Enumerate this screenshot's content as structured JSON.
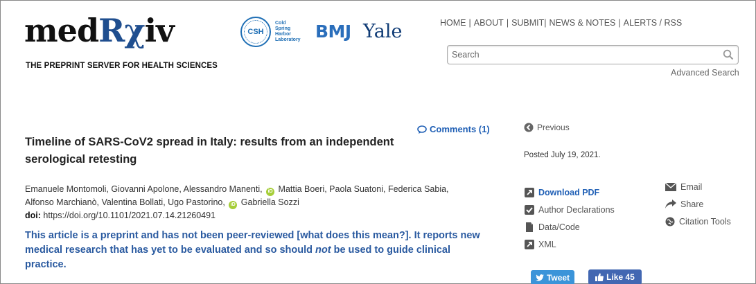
{
  "header": {
    "logo_pre": "med",
    "logo_rx": "Rχ",
    "logo_post": "iv",
    "tagline": "THE PREPRINT SERVER FOR HEALTH SCIENCES",
    "partners": {
      "csh_badge": "CSH",
      "csh_lines": [
        "Cold",
        "Spring",
        "Harbor",
        "Laboratory"
      ],
      "bmj": "BMJ",
      "yale": "Yale"
    },
    "nav": [
      "HOME",
      "ABOUT",
      "SUBMIT",
      "NEWS & NOTES",
      "ALERTS / RSS"
    ],
    "search_placeholder": "Search",
    "advanced_search": "Advanced Search"
  },
  "article": {
    "comments": "Comments (1)",
    "title": "Timeline of SARS-CoV2 spread in Italy: results from an independent serological retesting",
    "authors": {
      "a1": "Emanuele Montomoli, Giovanni Apolone, Alessandro Manenti,",
      "a2": "Mattia Boeri, Paola Suatoni, Federica Sabia,",
      "a3": "Alfonso Marchianò, Valentina Bollati, Ugo Pastorino,",
      "a4": "Gabriella Sozzi",
      "orcid_badge": "iD"
    },
    "doi_label": "doi:",
    "doi_value": "https://doi.org/10.1101/2021.07.14.21260491",
    "notice_a": "This article is a preprint and has not been peer-reviewed [what does this mean?]. It reports new medical research that has yet to be evaluated and so should ",
    "notice_em": "not",
    "notice_b": " be used to guide clinical practice."
  },
  "sidebar": {
    "previous": "Previous",
    "posted": "Posted July 19, 2021.",
    "download_pdf": "Download PDF",
    "author_declarations": "Author Declarations",
    "data_code": "Data/Code",
    "xml": "XML",
    "email": "Email",
    "share": "Share",
    "citation_tools": "Citation Tools",
    "tweet": "Tweet",
    "like": "Like 45"
  }
}
